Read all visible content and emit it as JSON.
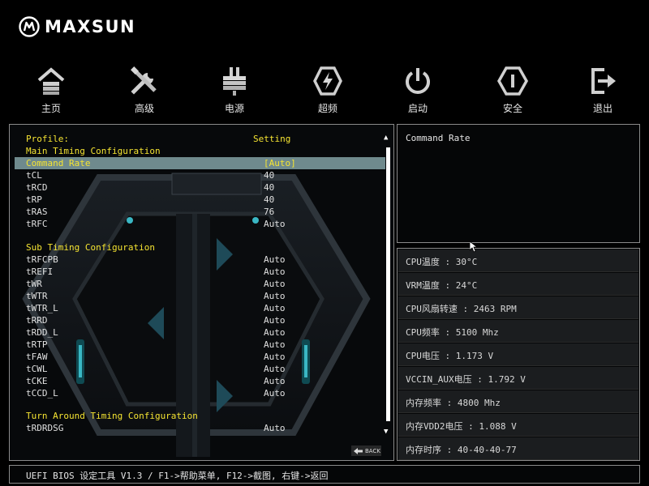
{
  "brand": {
    "name": "MAXSUN"
  },
  "nav": [
    {
      "id": "home",
      "label": "主页",
      "icon": "home-icon"
    },
    {
      "id": "advanced",
      "label": "高级",
      "icon": "tools-icon"
    },
    {
      "id": "power",
      "label": "电源",
      "icon": "power-plug-icon"
    },
    {
      "id": "overclock",
      "label": "超频",
      "icon": "lightning-icon"
    },
    {
      "id": "boot",
      "label": "启动",
      "icon": "power-button-icon"
    },
    {
      "id": "security",
      "label": "安全",
      "icon": "security-icon"
    },
    {
      "id": "exit",
      "label": "退出",
      "icon": "exit-icon"
    }
  ],
  "settings": {
    "header_left": "Profile:",
    "header_right": "Setting",
    "rows": [
      {
        "label": "Main Timing Configuration",
        "value": "",
        "kind": "section"
      },
      {
        "label": "Command Rate",
        "value": "[Auto]",
        "kind": "item",
        "selected": true
      },
      {
        "label": "tCL",
        "value": "40",
        "kind": "item"
      },
      {
        "label": "tRCD",
        "value": "40",
        "kind": "item"
      },
      {
        "label": "tRP",
        "value": "40",
        "kind": "item"
      },
      {
        "label": "tRAS",
        "value": "76",
        "kind": "item"
      },
      {
        "label": "tRFC",
        "value": "Auto",
        "kind": "item"
      },
      {
        "label": "",
        "value": "",
        "kind": "blank"
      },
      {
        "label": "Sub Timing Configuration",
        "value": "",
        "kind": "section"
      },
      {
        "label": "tRFCPB",
        "value": "Auto",
        "kind": "item"
      },
      {
        "label": "tREFI",
        "value": "Auto",
        "kind": "item"
      },
      {
        "label": "tWR",
        "value": "Auto",
        "kind": "item"
      },
      {
        "label": "tWTR",
        "value": "Auto",
        "kind": "item"
      },
      {
        "label": "tWTR_L",
        "value": "Auto",
        "kind": "item"
      },
      {
        "label": "tRRD",
        "value": "Auto",
        "kind": "item"
      },
      {
        "label": "tRDD_L",
        "value": "Auto",
        "kind": "item"
      },
      {
        "label": "tRTP",
        "value": "Auto",
        "kind": "item"
      },
      {
        "label": "tFAW",
        "value": "Auto",
        "kind": "item"
      },
      {
        "label": "tCWL",
        "value": "Auto",
        "kind": "item"
      },
      {
        "label": "tCKE",
        "value": "Auto",
        "kind": "item"
      },
      {
        "label": "tCCD_L",
        "value": "Auto",
        "kind": "item"
      },
      {
        "label": "",
        "value": "",
        "kind": "blank"
      },
      {
        "label": "Turn Around Timing Configuration",
        "value": "",
        "kind": "section"
      },
      {
        "label": "tRDRDSG",
        "value": "Auto",
        "kind": "item"
      }
    ],
    "back_label": "BACK"
  },
  "help": {
    "text": "Command Rate"
  },
  "status": [
    "CPU温度 : 30°C",
    "VRM温度 : 24°C",
    "CPU风扇转速 : 2463 RPM",
    "CPU频率 : 5100 Mhz",
    "CPU电压 : 1.173 V",
    "VCCIN_AUX电压 : 1.792 V",
    "内存频率 : 4800 Mhz",
    "内存VDD2电压 : 1.088 V",
    "内存时序 : 40-40-40-77"
  ],
  "footer": {
    "text": "UEFI BIOS 设定工具 V1.3 / F1->帮助菜单, F12->截图, 右键->返回"
  },
  "colors": {
    "highlight_text": "#f5e432",
    "selection_bar": "#6f8a8d",
    "border": "#8a8a8a"
  }
}
